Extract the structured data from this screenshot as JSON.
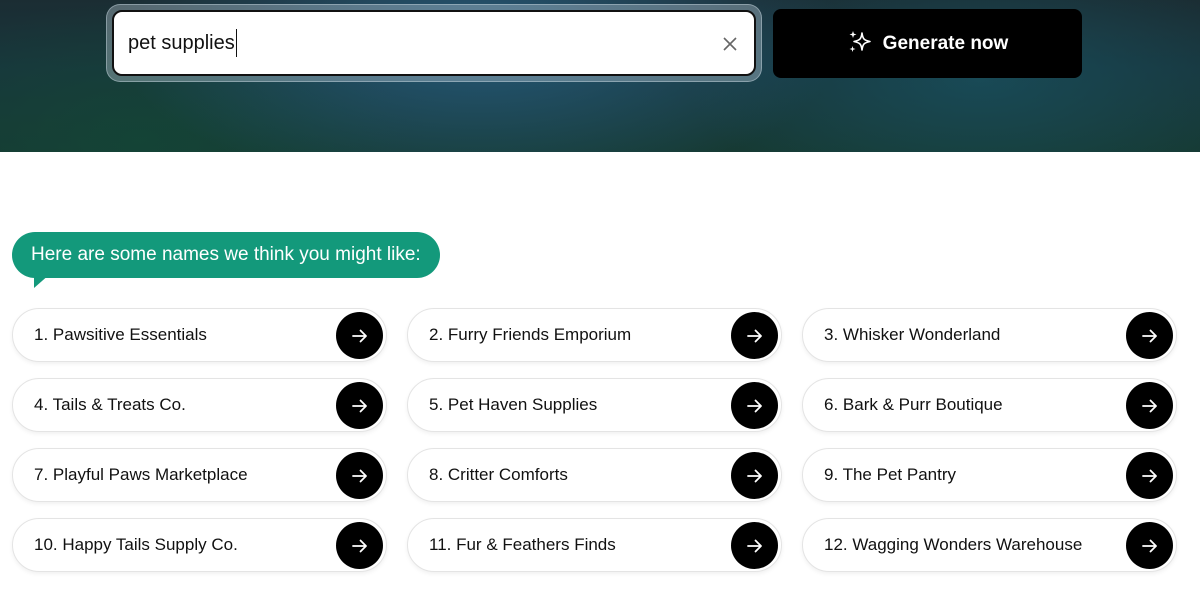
{
  "search": {
    "value": "pet supplies",
    "clear_icon": "close-icon"
  },
  "generate": {
    "label": "Generate now",
    "icon": "sparkles-icon"
  },
  "results": {
    "heading": "Here are some names we think you might like:",
    "arrow_icon": "arrow-right-icon",
    "names": [
      "1. Pawsitive Essentials",
      "2. Furry Friends Emporium",
      "3. Whisker Wonderland",
      "4. Tails & Treats Co.",
      "5. Pet Haven Supplies",
      "6. Bark & Purr Boutique",
      "7. Playful Paws Marketplace",
      "8. Critter Comforts",
      "9. The Pet Pantry",
      "10. Happy Tails Supply Co.",
      "11. Fur & Feathers Finds",
      "12. Wagging Wonders Warehouse"
    ]
  },
  "colors": {
    "accent": "#13997b",
    "button": "#000000"
  }
}
